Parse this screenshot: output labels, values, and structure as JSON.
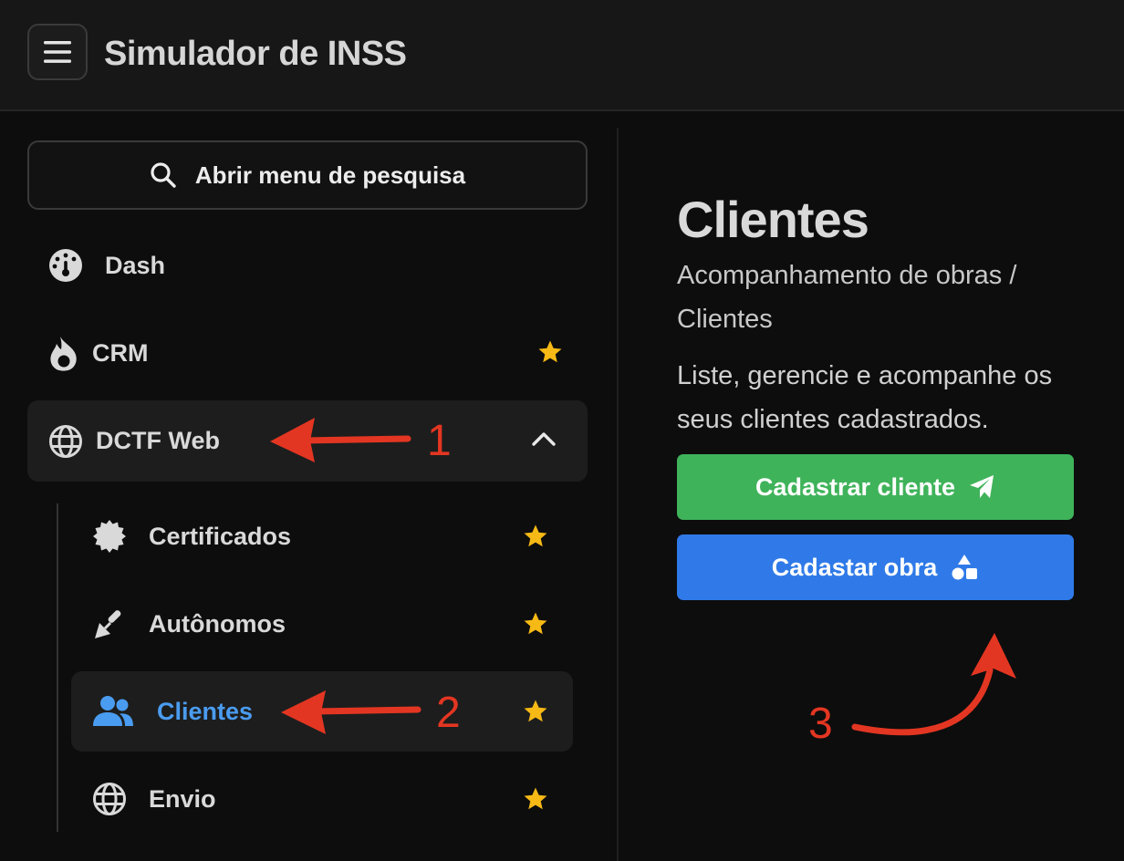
{
  "header": {
    "app_title": "Simulador de INSS",
    "menu_icon": "hamburger-menu-icon"
  },
  "sidebar": {
    "search_label": "Abrir menu de pesquisa",
    "items": [
      {
        "label": "Dash",
        "icon": "dashboard-gauge-icon",
        "favorite": false
      },
      {
        "label": "CRM",
        "icon": "fire-icon",
        "favorite": true
      },
      {
        "label": "DCTF Web",
        "icon": "globe-icon",
        "expanded": true,
        "children": [
          {
            "label": "Certificados",
            "icon": "certificate-badge-icon",
            "favorite": true
          },
          {
            "label": "Autônomos",
            "icon": "trowel-icon",
            "favorite": true
          },
          {
            "label": "Clientes",
            "icon": "users-icon",
            "favorite": true,
            "active": true
          },
          {
            "label": "Envio",
            "icon": "globe-icon",
            "favorite": true
          }
        ]
      }
    ]
  },
  "main": {
    "title": "Clientes",
    "breadcrumb": "Acompanhamento de obras / Clientes",
    "description": "Liste, gerencie e acompanhe os seus clientes cadastrados.",
    "buttons": [
      {
        "label": "Cadastrar cliente",
        "icon": "paper-plane-icon",
        "color": "#3fb35a"
      },
      {
        "label": "Cadastar obra",
        "icon": "shapes-icon",
        "color": "#2f7ae8"
      }
    ]
  },
  "annotations": [
    "1",
    "2",
    "3"
  ],
  "colors": {
    "accent_blue": "#4a9cf0",
    "star": "#f6b915",
    "annotation_red": "#e33622"
  }
}
